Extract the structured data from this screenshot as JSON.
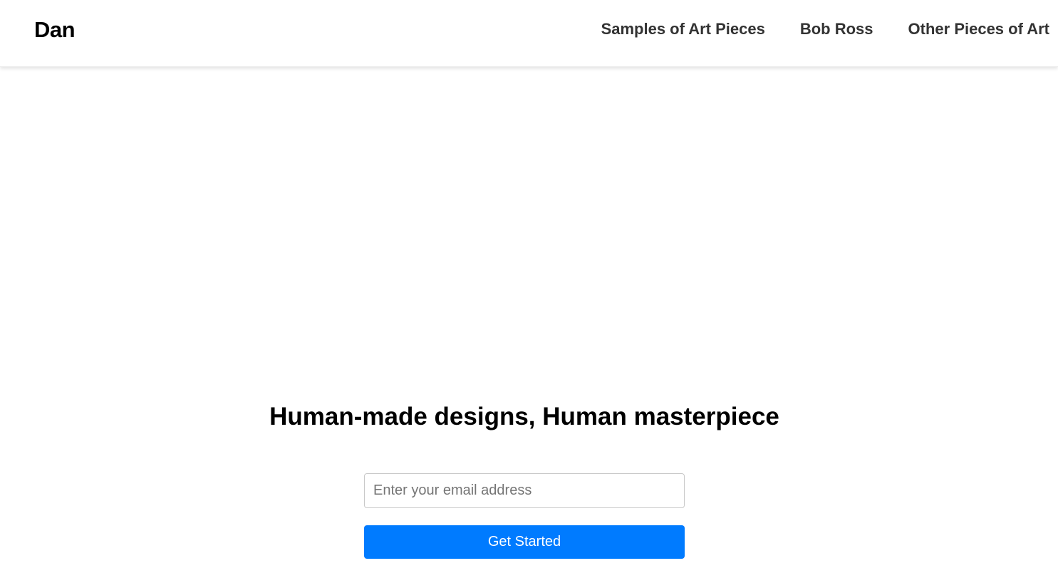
{
  "header": {
    "logo": "Dan",
    "nav": [
      {
        "label": "Samples of Art Pieces"
      },
      {
        "label": "Bob Ross"
      },
      {
        "label": "Other Pieces of Art"
      }
    ]
  },
  "hero": {
    "title": "Human-made designs, Human masterpiece",
    "email_placeholder": "Enter your email address",
    "email_value": "",
    "cta_label": "Get Started"
  },
  "colors": {
    "accent": "#007bff",
    "nav_text": "#333333",
    "title_text": "#000000"
  }
}
